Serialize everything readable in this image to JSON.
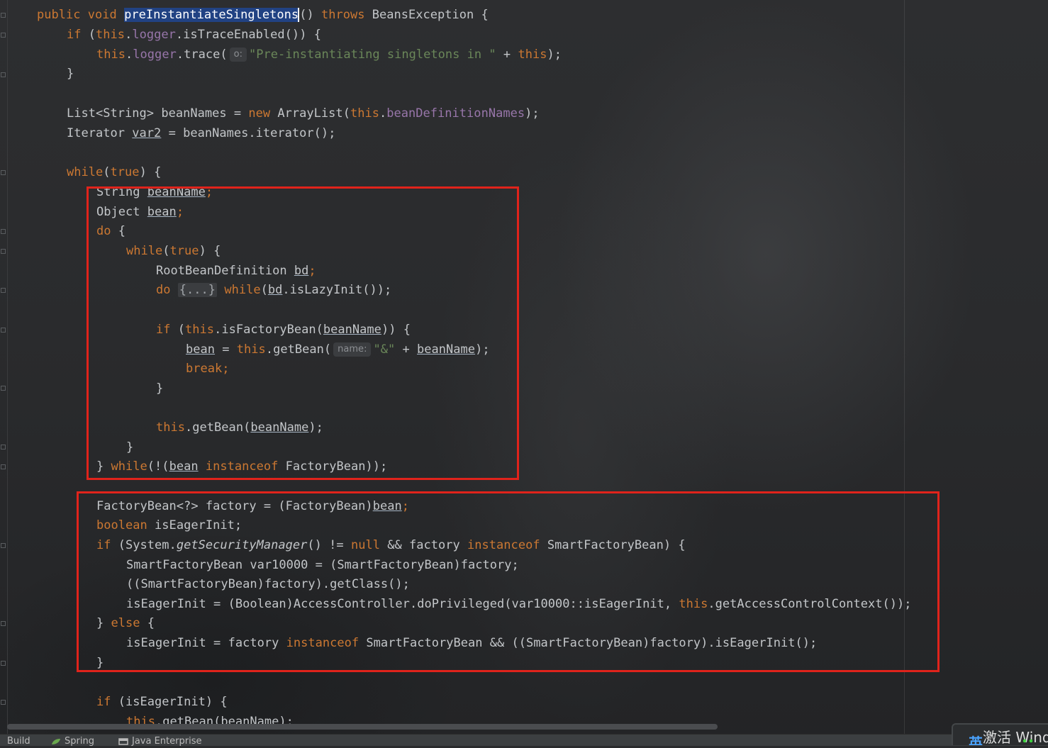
{
  "colors": {
    "background": "#2a2b2d",
    "keyword": "#cc7832",
    "field": "#9876aa",
    "string": "#6a8759",
    "default_text": "#c3c6c9",
    "highlight_box": "#e0231b",
    "selection": "#214283"
  },
  "code": {
    "l1": {
      "a": "public void ",
      "sel": "preInstantiateSingletons",
      "b": "() ",
      "c": "throws",
      "d": " BeansException {"
    },
    "l2": {
      "a": "if",
      "b": " (",
      "c": "this",
      "d": ".",
      "e": "logger",
      "f": ".isTraceEnabled()) {"
    },
    "l3": {
      "a": "this",
      "b": ".",
      "c": "logger",
      "d": ".trace(",
      "hint": "o:",
      "e": "\"Pre-instantiating singletons in \"",
      "f": " + ",
      "g": "this",
      "h": ");"
    },
    "l4": "}",
    "l5": {
      "a": "List<String> beanNames = ",
      "b": "new",
      "c": " ArrayList(",
      "d": "this",
      "e": ".",
      "f": "beanDefinitionNames",
      "g": ");"
    },
    "l6": {
      "a": "Iterator ",
      "b": "var2",
      "c": " = beanNames.iterator();"
    },
    "l7": {
      "a": "while",
      "b": "(",
      "c": "true",
      "d": ") {"
    },
    "l8": {
      "a": "String ",
      "b": "beanName",
      "c": ";"
    },
    "l9": {
      "a": "Object ",
      "b": "bean",
      "c": ";"
    },
    "l10": {
      "a": "do",
      "b": " {"
    },
    "l11": {
      "a": "while",
      "b": "(",
      "c": "true",
      "d": ") {"
    },
    "l12": {
      "a": "RootBeanDefinition ",
      "b": "bd",
      "c": ";"
    },
    "l13": {
      "a": "do",
      "b": " ",
      "folded": "{...}",
      "c": " ",
      "d": "while",
      "e": "(",
      "f": "bd",
      "g": ".isLazyInit());"
    },
    "l14": {
      "a": "if",
      "b": " (",
      "c": "this",
      "d": ".isFactoryBean(",
      "e": "beanName",
      "f": ")) {"
    },
    "l15": {
      "a": "bean",
      "b": " = ",
      "c": "this",
      "d": ".getBean(",
      "hint": "name:",
      "e": "\"&\"",
      "f": " + ",
      "g": "beanName",
      "h": ");"
    },
    "l16": {
      "a": "break",
      "b": ";"
    },
    "l17": "}",
    "l18": {
      "a": "this",
      "b": ".getBean(",
      "c": "beanName",
      "d": ");"
    },
    "l19": "}",
    "l20": {
      "a": "} ",
      "b": "while",
      "c": "(!(",
      "d": "bean",
      "e": " ",
      "f": "instanceof",
      "g": " FactoryBean));"
    },
    "l21": {
      "a": "FactoryBean<?> factory = (FactoryBean)",
      "b": "bean",
      "c": ";"
    },
    "l22": {
      "a": "boolean",
      "b": " isEagerInit;"
    },
    "l23": {
      "a": "if",
      "b": " (System.",
      "c": "getSecurityManager",
      "d": "() != ",
      "e": "null",
      "f": " && factory ",
      "g": "instanceof",
      "h": " SmartFactoryBean) {"
    },
    "l24": "SmartFactoryBean var10000 = (SmartFactoryBean)factory;",
    "l25": "((SmartFactoryBean)factory).getClass();",
    "l26": {
      "a": "isEagerInit = (Boolean)AccessController.doPrivileged(var10000::isEagerInit, ",
      "b": "this",
      "c": ".getAccessControlContext());"
    },
    "l27": {
      "a": "} ",
      "b": "else",
      "c": " {"
    },
    "l28": {
      "a": "isEagerInit = factory ",
      "b": "instanceof",
      "c": " SmartFactoryBean && ((SmartFactoryBean)factory).isEagerInit();"
    },
    "l29": "}",
    "l30": {
      "a": "if",
      "b": " (isEagerInit) {"
    },
    "l31": {
      "a": "this",
      "b": ".getBean(",
      "c": "beanName",
      "d": ");"
    }
  },
  "tool_windows": {
    "build": "Build",
    "spring": "Spring",
    "java_enterprise": "Java Enterprise"
  },
  "watermark": {
    "ime": "英",
    "text": "激活 Wind"
  }
}
